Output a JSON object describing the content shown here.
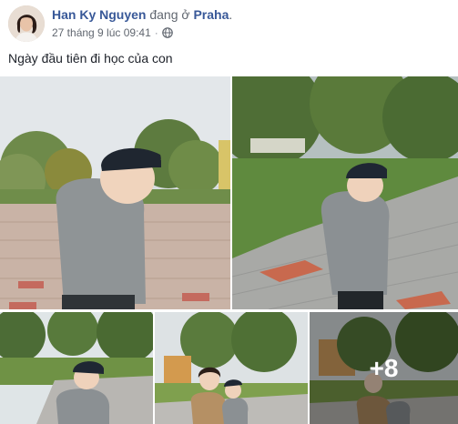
{
  "post": {
    "author_name": "Han Ky Nguyen",
    "location_prefix": "đang ở",
    "location": "Praha",
    "location_suffix": ".",
    "timestamp": "27 tháng 9 lúc 09:41",
    "separator": "·",
    "privacy_icon": "globe-icon",
    "caption": "Ngày đầu tiên đi học của con"
  },
  "gallery": {
    "more_count_label": "+8"
  },
  "colors": {
    "link_blue": "#385898",
    "text": "#1d2129",
    "meta_gray": "#616770"
  }
}
